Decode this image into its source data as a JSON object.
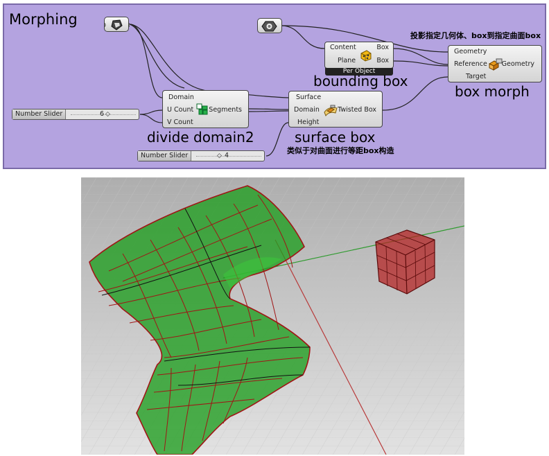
{
  "canvas": {
    "title": "Morphing",
    "background": "#b4a3e0",
    "annotations": {
      "bounding_box": "bounding box",
      "box_morph": "box morph",
      "divide_domain2": "divide domain2",
      "surface_box": "surface box",
      "note_top": "投影指定几何体、box到指定曲面box",
      "note_bottom": "类似于对曲面进行等距box构造"
    },
    "components": {
      "bounding_box": {
        "inputs": [
          "Content",
          "Plane"
        ],
        "outputs": [
          "Box",
          "Box"
        ],
        "footer": "Per Object"
      },
      "box_morph": {
        "inputs": [
          "Geometry",
          "Reference",
          "Target"
        ],
        "outputs": [
          "Geometry"
        ]
      },
      "divide_domain2": {
        "inputs": [
          "Domain",
          "U Count",
          "V Count"
        ],
        "outputs": [
          "Segments"
        ]
      },
      "surface_box": {
        "inputs": [
          "Surface",
          "Domain",
          "Height"
        ],
        "outputs": [
          "Twisted Box"
        ]
      }
    },
    "sliders": [
      {
        "name": "Number Slider",
        "value": "6"
      },
      {
        "name": "Number Slider",
        "value": "4"
      }
    ],
    "params": [
      {
        "icon": "brep-param-icon"
      },
      {
        "icon": "geometry-param-icon"
      }
    ]
  },
  "viewport": {
    "surface_color": "#22a322",
    "edge_color": "#b01818",
    "box_color": "#b42020",
    "grid_color": "#c9c9c9",
    "axis_x_color": "#b83a3a",
    "axis_y_color": "#2f9b2f"
  }
}
